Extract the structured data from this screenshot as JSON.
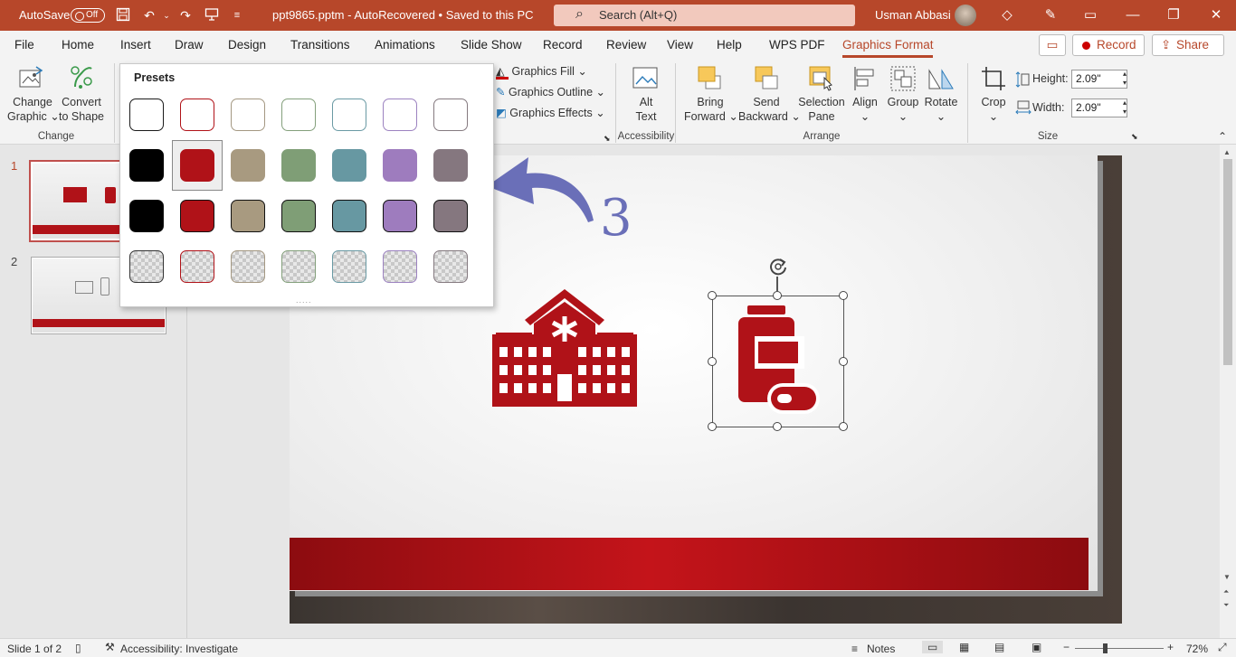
{
  "titlebar": {
    "autosave_label": "AutoSave",
    "autosave_state": "Off",
    "doc_title": "ppt9865.pptm  -  AutoRecovered  •  Saved to this PC",
    "search_placeholder": "Search (Alt+Q)",
    "user_name": "Usman Abbasi",
    "bg_color": "#b7472a"
  },
  "tabs": {
    "items": [
      "File",
      "Home",
      "Insert",
      "Draw",
      "Design",
      "Transitions",
      "Animations",
      "Slide Show",
      "Record",
      "Review",
      "View",
      "Help",
      "WPS PDF",
      "Graphics Format"
    ],
    "active": "Graphics Format",
    "record_button": "Record",
    "share_button": "Share"
  },
  "ribbon": {
    "change_graphic": [
      "Change",
      "Graphic"
    ],
    "convert_shape": [
      "Convert",
      "to Shape"
    ],
    "group_change": "Change",
    "graphics_fill": "Graphics Fill",
    "graphics_outline": "Graphics Outline",
    "graphics_effects": "Graphics Effects",
    "alt_text": [
      "Alt",
      "Text"
    ],
    "group_accessibility": "Accessibility",
    "bring_forward": [
      "Bring",
      "Forward"
    ],
    "send_backward": [
      "Send",
      "Backward"
    ],
    "selection_pane": [
      "Selection",
      "Pane"
    ],
    "align": "Align",
    "group": "Group",
    "rotate": "Rotate",
    "group_arrange": "Arrange",
    "crop": "Crop",
    "height_label": "Height:",
    "height_value": "2.09\"",
    "width_label": "Width:",
    "width_value": "2.09\"",
    "group_size": "Size"
  },
  "presets": {
    "title": "Presets",
    "rows": [
      {
        "style": "outline",
        "colors": [
          "#1a1a1a",
          "#b01218",
          "#a49882",
          "#84a07c",
          "#6a9aa4",
          "#9c82c0",
          "#857a80"
        ]
      },
      {
        "style": "solid",
        "colors": [
          "#000000",
          "#b01218",
          "#a89a80",
          "#7f9e76",
          "#6798a2",
          "#9e7cbe",
          "#85777f"
        ]
      },
      {
        "style": "solid-dark-border",
        "colors": [
          "#000000",
          "#b01218",
          "#a89a80",
          "#7f9e76",
          "#6798a2",
          "#9e7cbe",
          "#85777f"
        ]
      },
      {
        "style": "transparent",
        "colors": [
          "#333333",
          "#b01218",
          "#a49882",
          "#84a07c",
          "#6a9aa4",
          "#9c82c0",
          "#857a80"
        ]
      }
    ],
    "selected": "row2-col2",
    "more_indicator": "....."
  },
  "annotation": {
    "number": "3",
    "color": "#6a6fb8"
  },
  "thumbnails": {
    "items": [
      {
        "number": "1",
        "selected": true
      },
      {
        "number": "2",
        "selected": false
      }
    ]
  },
  "slide": {
    "accent_color": "#b01218",
    "icons": [
      "hospital-icon",
      "medicine-bottle-icon"
    ]
  },
  "status": {
    "slide_info": "Slide 1 of 2",
    "accessibility": "Accessibility: Investigate",
    "notes": "Notes",
    "zoom": "72%"
  }
}
